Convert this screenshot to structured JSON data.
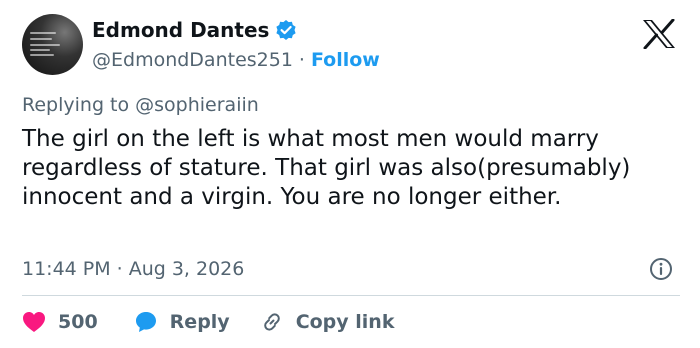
{
  "author": {
    "display_name": "Edmond Dantes",
    "handle": "@EdmondDantes251",
    "separator": "·",
    "follow_label": "Follow",
    "verified": true
  },
  "reply_context": {
    "prefix": "Replying to ",
    "mention": "@sophieraiin"
  },
  "tweet": {
    "text": "The girl on the left is what most men would marry regardless of stature. That girl was also(presumably) innocent and a virgin. You are no longer either.",
    "time": "11:44 PM",
    "separator": "·",
    "date": "Aug 3, 2026"
  },
  "actions": {
    "likes": "500",
    "reply_label": "Reply",
    "copy_link_label": "Copy link"
  },
  "colors": {
    "link_blue": "#1d9bf0",
    "like_red": "#f91880",
    "muted_text": "#536471",
    "body_text": "#0f1419",
    "divider": "#cfd9de"
  },
  "icons": {
    "verified": "verified-badge-icon",
    "platform": "x-logo-icon",
    "info": "info-icon",
    "like": "heart-icon",
    "reply": "reply-bubble-icon",
    "copy": "link-icon"
  }
}
